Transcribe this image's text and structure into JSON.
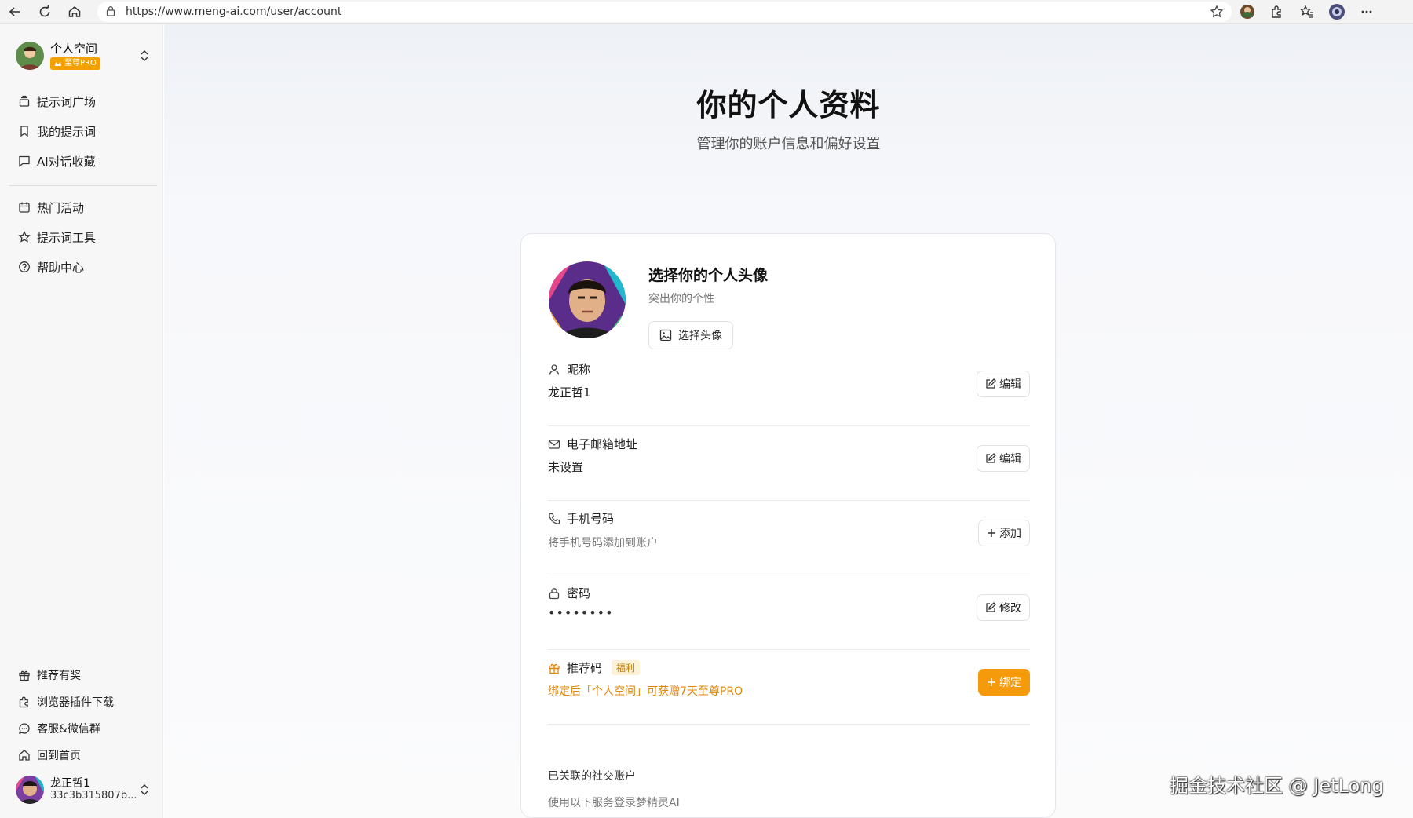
{
  "browser": {
    "url": "https://www.meng-ai.com/user/account"
  },
  "sidebar": {
    "workspace": {
      "name": "个人空间",
      "badge": "至尊PRO"
    },
    "items": [
      {
        "label": "提示词广场",
        "icon": "layers-icon"
      },
      {
        "label": "我的提示词",
        "icon": "bookmark-icon"
      },
      {
        "label": "AI对话收藏",
        "icon": "chat-icon"
      },
      {
        "label": "热门活动",
        "icon": "calendar-icon"
      },
      {
        "label": "提示词工具",
        "icon": "star-icon"
      },
      {
        "label": "帮助中心",
        "icon": "help-icon"
      }
    ],
    "bottom_items": [
      {
        "label": "推荐有奖",
        "icon": "gift-icon"
      },
      {
        "label": "浏览器插件下载",
        "icon": "puzzle-icon"
      },
      {
        "label": "客服&微信群",
        "icon": "message-icon"
      },
      {
        "label": "回到首页",
        "icon": "home-icon"
      }
    ],
    "user": {
      "name": "龙正哲1",
      "id": "33c3b315807b..."
    }
  },
  "main": {
    "title": "你的个人资料",
    "subtitle": "管理你的账户信息和偏好设置",
    "avatar_section": {
      "title": "选择你的个人头像",
      "subtitle": "突出你的个性",
      "button": "选择头像"
    },
    "fields": {
      "nickname": {
        "label": "昵称",
        "value": "龙正哲1",
        "button": "编辑"
      },
      "email": {
        "label": "电子邮箱地址",
        "value": "未设置",
        "button": "编辑"
      },
      "phone": {
        "label": "手机号码",
        "hint": "将手机号码添加到账户",
        "button": "添加"
      },
      "password": {
        "label": "密码",
        "value": "••••••••",
        "button": "修改"
      },
      "referral": {
        "label": "推荐码",
        "tag": "福利",
        "hint": "绑定后「个人空间」可获赠7天至尊PRO",
        "button": "绑定"
      }
    },
    "social": {
      "title": "已关联的社交账户",
      "subtitle": "使用以下服务登录梦精灵AI"
    }
  },
  "watermark": "掘金技术社区 @ JetLong",
  "colors": {
    "accent": "#f59a0a",
    "pro_badge": "#f4a100",
    "referral_text": "#e0860b"
  }
}
